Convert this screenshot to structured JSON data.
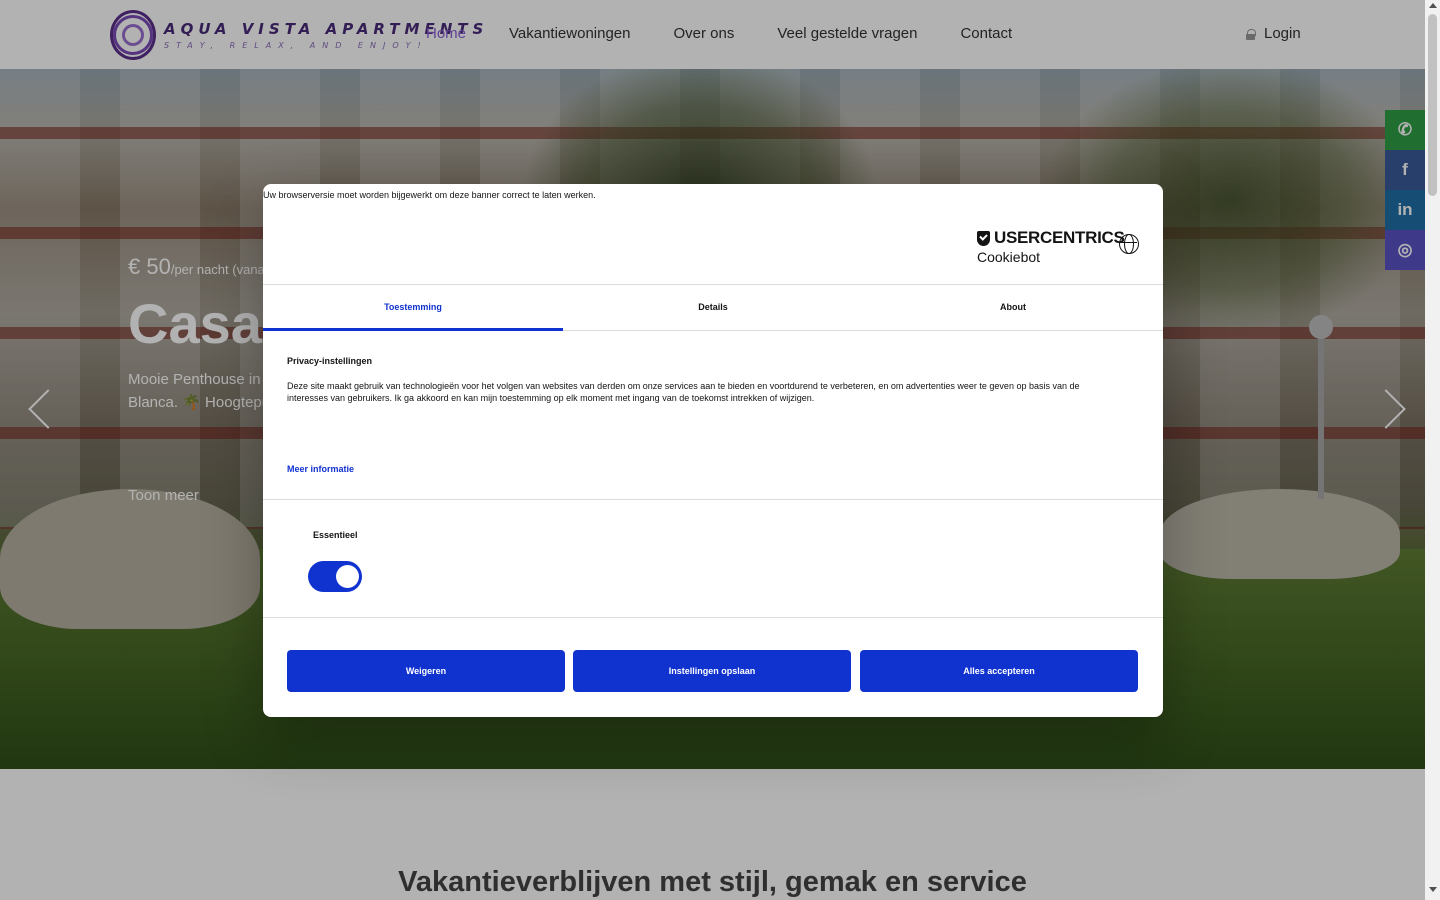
{
  "header": {
    "logo_title": "AQUA VISTA APARTMENTS",
    "logo_tagline": "STAY, RELAX, AND ENJOY!",
    "nav": [
      {
        "label": "Home"
      },
      {
        "label": "Vakantiewoningen"
      },
      {
        "label": "Over ons"
      },
      {
        "label": "Veel gestelde vragen"
      },
      {
        "label": "Contact"
      }
    ],
    "login_label": "Login",
    "active_color": "#8b5cd6"
  },
  "hero": {
    "price": "€ 50",
    "price_unit": "/per nacht (vanaf)",
    "title": "Casa",
    "description": "Mooie Penthouse in prachtige penthouse en moderne apparte Blanca. 🌴 Hoogtepun",
    "more_label": "Toon meer"
  },
  "social": [
    {
      "icon": "whatsapp-icon",
      "glyph": "✆"
    },
    {
      "icon": "facebook-icon",
      "glyph": "f"
    },
    {
      "icon": "linkedin-icon",
      "glyph": "in"
    },
    {
      "icon": "instagram-icon",
      "glyph": "◎"
    }
  ],
  "section": {
    "title": "Vakantieverblijven met stijl, gemak en service"
  },
  "cookie": {
    "warning": "Uw browserversie moet worden bijgewerkt om deze banner correct te laten werken.",
    "brand": "USERCENTRICS",
    "product": "Cookiebot",
    "tabs": [
      {
        "label": "Toestemming"
      },
      {
        "label": "Details"
      },
      {
        "label": "About"
      }
    ],
    "privacy_title": "Privacy-instellingen",
    "privacy_text": "Deze site maakt gebruik van technologieën voor het volgen van websites van derden om onze services aan te bieden en voortdurend te verbeteren, en om advertenties weer te geven op basis van de interesses van gebruikers. Ik ga akkoord en kan mijn toestemming op elk moment met ingang van de toekomst intrekken of wijzigen.",
    "more_info": "Meer informatie",
    "essential_label": "Essentieel",
    "essential_enabled": true,
    "buttons": {
      "deny": "Weigeren",
      "save": "Instellingen opslaan",
      "accept": "Alles accepteren"
    },
    "accent_color": "#1032cf"
  }
}
